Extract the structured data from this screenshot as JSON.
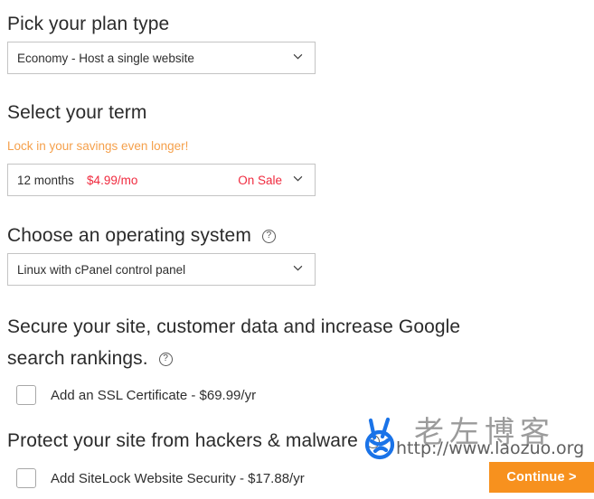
{
  "plan": {
    "heading": "Pick your plan type",
    "selected": "Economy - Host a single website",
    "chevron_icon": "chevron-down-icon"
  },
  "term": {
    "heading": "Select your term",
    "savings_note": "Lock in your savings even longer!",
    "months": "12 months",
    "price": "$4.99/mo",
    "sale_badge": "On Sale",
    "chevron_icon": "chevron-down-icon"
  },
  "os": {
    "heading": "Choose an operating system",
    "help_icon": "help-circle-icon",
    "selected": "Linux with cPanel control panel",
    "chevron_icon": "chevron-down-icon"
  },
  "ssl": {
    "heading_line1": "Secure your site, customer data and increase Google",
    "heading_line2": "search rankings.",
    "help_icon": "help-circle-icon",
    "checkbox_label": "Add an SSL Certificate - $69.99/yr",
    "checked": false
  },
  "sitelock": {
    "heading": "Protect your site from hackers & malware",
    "help_icon": "help-circle-icon",
    "checkbox_label": "Add SiteLock Website Security - $17.88/yr",
    "checked": false
  },
  "footer": {
    "continue_label": "Continue >"
  },
  "watermark": {
    "logo_icon": "victory-hand-icon",
    "brand_cn": "老左博客",
    "url": "http://www.laozuo.org"
  },
  "colors": {
    "accent_orange": "#f7911e",
    "sale_red": "#f02b3f",
    "savings_orange": "#f5a04b",
    "border_gray": "#c4c4c4",
    "text_dark": "#2b2b2b",
    "watermark_blue": "#1a73e8"
  }
}
